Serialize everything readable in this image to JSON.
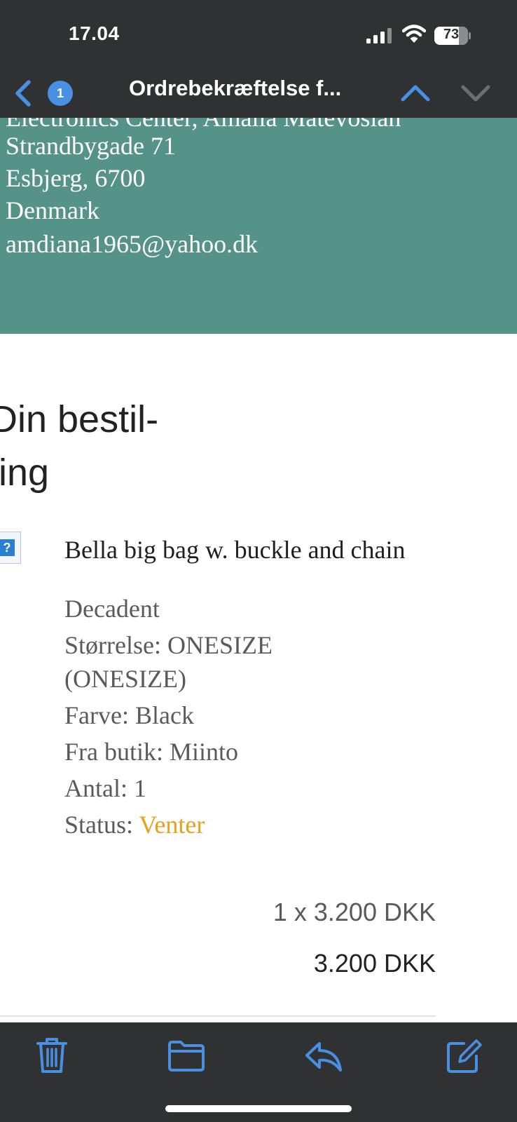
{
  "status_bar": {
    "time": "17.04",
    "battery_level": "73",
    "icons": [
      "cellular-signal-icon",
      "wifi-icon",
      "battery-icon"
    ]
  },
  "nav": {
    "unread_count": "1",
    "title": "Ordrebekræftelse f...",
    "icons": [
      "back-chevron-icon",
      "chevron-up-icon",
      "chevron-down-icon"
    ],
    "colors": {
      "accent": "#4a90e2",
      "bar": "#2f3133"
    }
  },
  "address": {
    "partial_line": "Electronics Center, Amalia Matevosian",
    "street": "Strandbygade 71",
    "city_postcode": "Esbjerg, 6700",
    "country": "Denmark",
    "email": "amdiana1965@yahoo.dk",
    "background": "#559287"
  },
  "order": {
    "heading_line1": "Din bestil-",
    "heading_line2": "ling",
    "item": {
      "image_icon": "missing-image-icon",
      "name": "Bella big bag w. buckle and chain",
      "brand": "Decadent",
      "size_line1": "Størrelse: ONESIZE",
      "size_line2": "(ONESIZE)",
      "color": "Farve: Black",
      "shop": "Fra butik: Miinto",
      "quantity": "Antal: 1",
      "status_label": "Status: ",
      "status_value": "Venter",
      "status_color": "#e8a11c"
    },
    "unit_price": "1 x 3.200 DKK",
    "total_price": "3.200 DKK"
  },
  "toolbar": {
    "icons": [
      "trash-icon",
      "folder-icon",
      "reply-icon",
      "compose-icon"
    ]
  }
}
